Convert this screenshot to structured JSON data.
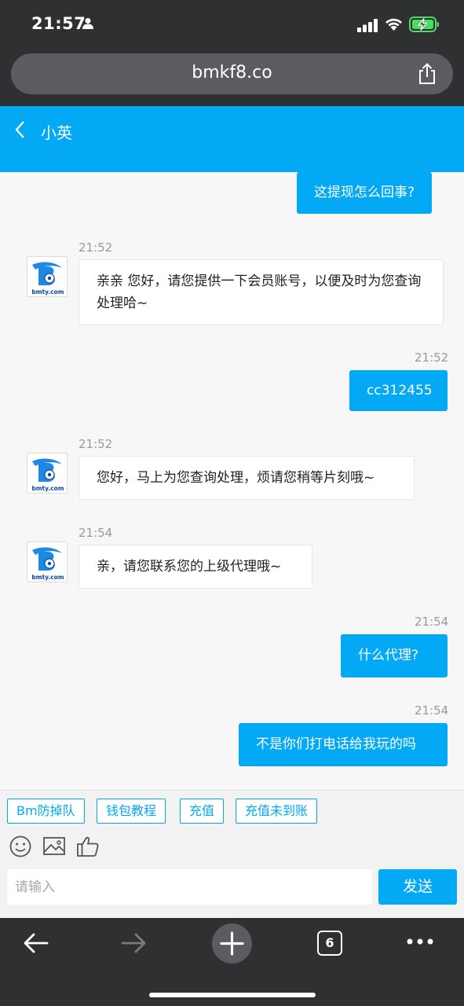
{
  "status_bar": {
    "time": "21:57"
  },
  "browser": {
    "url": "bmkf8.co",
    "tabs_count": "6"
  },
  "header": {
    "title": "小英"
  },
  "messages": [
    {
      "from": "me",
      "text": "这提现怎么回事?"
    },
    {
      "from": "agent",
      "time": "21:52",
      "text": "亲亲 您好，请您提供一下会员账号，以便及时为您查询处理哈~"
    },
    {
      "from": "me",
      "time": "21:52",
      "text": "cc312455"
    },
    {
      "from": "agent",
      "time": "21:52",
      "text": "您好，马上为您查询处理，烦请您稍等片刻哦~"
    },
    {
      "from": "agent",
      "time": "21:54",
      "text": "亲，请您联系您的上级代理哦~"
    },
    {
      "from": "me",
      "time": "21:54",
      "text": "什么代理?"
    },
    {
      "from": "me",
      "time": "21:54",
      "text": "不是你们打电话给我玩的吗"
    }
  ],
  "avatar": {
    "logo_text": "bmty.com",
    "brand_color": "#1e88e5"
  },
  "quick_replies": [
    "Bm防掉队",
    "钱包教程",
    "充值",
    "充值未到账"
  ],
  "composer": {
    "placeholder": "请输入",
    "send_label": "发送"
  },
  "colors": {
    "accent": "#03a9f4",
    "chrome": "#2f3032"
  }
}
